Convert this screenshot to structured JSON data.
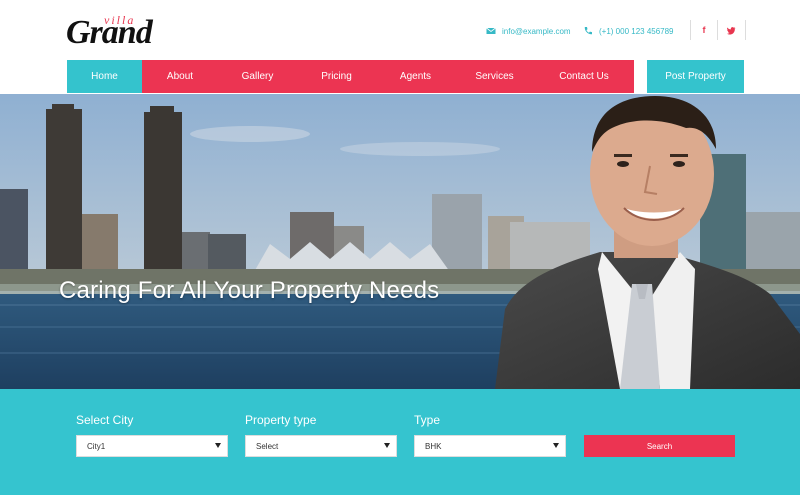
{
  "brand": {
    "name": "Grand",
    "tagline": "villa"
  },
  "header": {
    "email": "info@example.com",
    "phone": "(+1) 000 123 456789",
    "social": {
      "facebook": "f",
      "twitter": "twitter-icon"
    }
  },
  "nav": {
    "items": [
      "Home",
      "About",
      "Gallery",
      "Pricing",
      "Agents",
      "Services",
      "Contact Us"
    ],
    "active": "Home",
    "post_label": "Post Property"
  },
  "hero": {
    "heading": "Caring For All Your Property Needs"
  },
  "search": {
    "city": {
      "label": "Select City",
      "value": "City1"
    },
    "property_type": {
      "label": "Property type",
      "value": "Select"
    },
    "type": {
      "label": "Type",
      "value": "BHK"
    },
    "button": "Search"
  },
  "colors": {
    "accent_red": "#ec3452",
    "accent_teal": "#34c3cd"
  }
}
